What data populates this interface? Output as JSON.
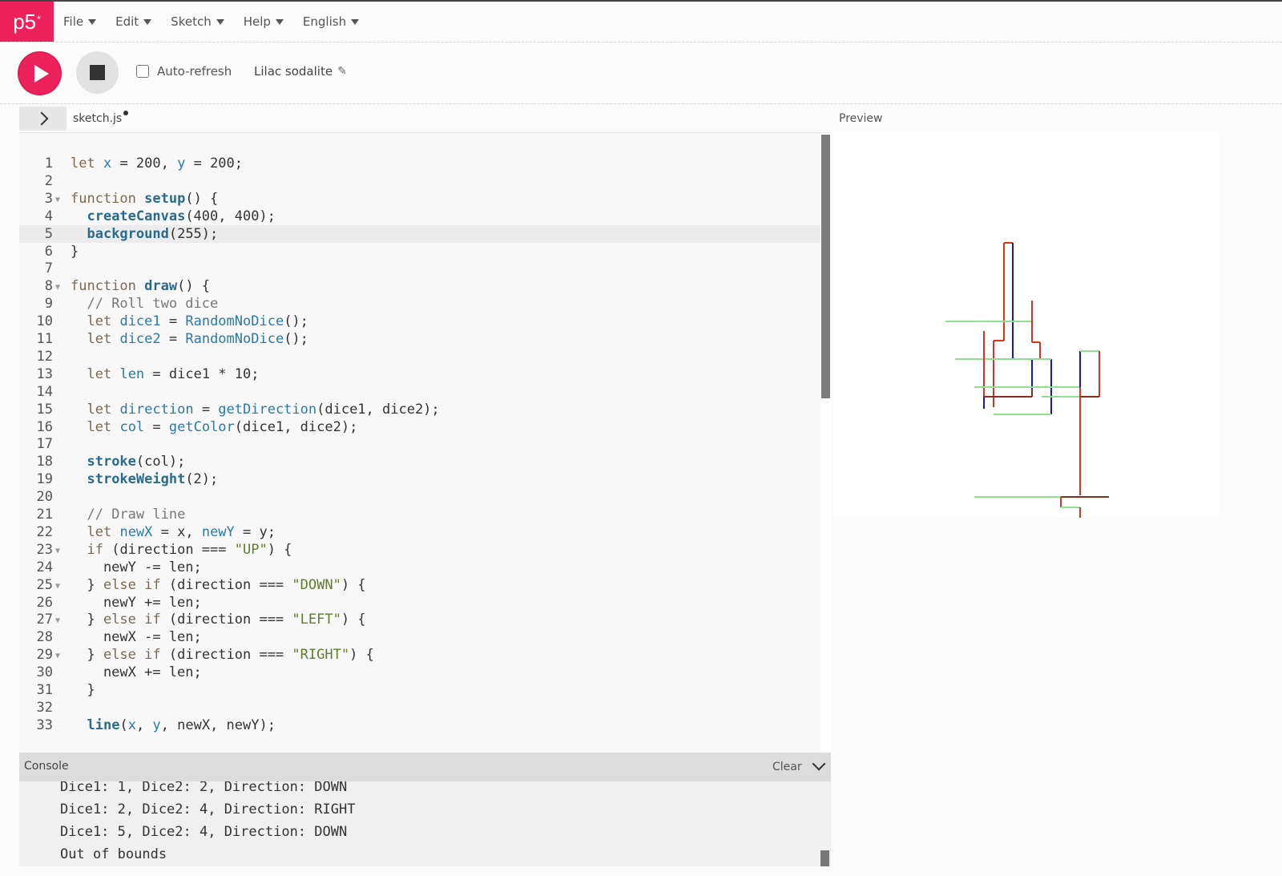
{
  "app": {
    "logo_text": "p5",
    "logo_mark": "*"
  },
  "colors": {
    "brand": "#ed225d",
    "stroke_red": "#e0301e",
    "stroke_blue": "#1414d8",
    "stroke_green": "#8fe08f",
    "stroke_brown": "#8b2a1e"
  },
  "menu": [
    {
      "label": "File"
    },
    {
      "label": "Edit"
    },
    {
      "label": "Sketch"
    },
    {
      "label": "Help"
    },
    {
      "label": "English"
    }
  ],
  "toolbar": {
    "auto_refresh_label": "Auto-refresh",
    "auto_refresh_checked": false,
    "project_name": "Lilac sodalite"
  },
  "editor": {
    "file_name": "sketch.js",
    "active_line": 5,
    "lines": [
      "let x = 200, y = 200;",
      "",
      "function setup() {",
      "  createCanvas(400, 400);",
      "  background(255);",
      "}",
      "",
      "function draw() {",
      "  // Roll two dice",
      "  let dice1 = RandomNoDice();",
      "  let dice2 = RandomNoDice();",
      "",
      "  let len = dice1 * 10;",
      "",
      "  let direction = getDirection(dice1, dice2);",
      "  let col = getColor(dice1, dice2);",
      "",
      "  stroke(col);",
      "  strokeWeight(2);",
      "",
      "  // Draw line",
      "  let newX = x, newY = y;",
      "  if (direction === \"UP\") {",
      "    newY -= len;",
      "  } else if (direction === \"DOWN\") {",
      "    newY += len;",
      "  } else if (direction === \"LEFT\") {",
      "    newX -= len;",
      "  } else if (direction === \"RIGHT\") {",
      "    newX += len;",
      "  }",
      "",
      "  line(x, y, newX, newY);"
    ]
  },
  "preview": {
    "label": "Preview"
  },
  "console": {
    "title": "Console",
    "clear_label": "Clear",
    "lines": [
      "Dice1: 1, Dice2: 2, Direction: DOWN",
      "Dice1: 2, Dice2: 4, Direction: RIGHT",
      "Dice1: 5, Dice2: 4, Direction: DOWN",
      "Out of bounds"
    ],
    "prompt": "›"
  }
}
